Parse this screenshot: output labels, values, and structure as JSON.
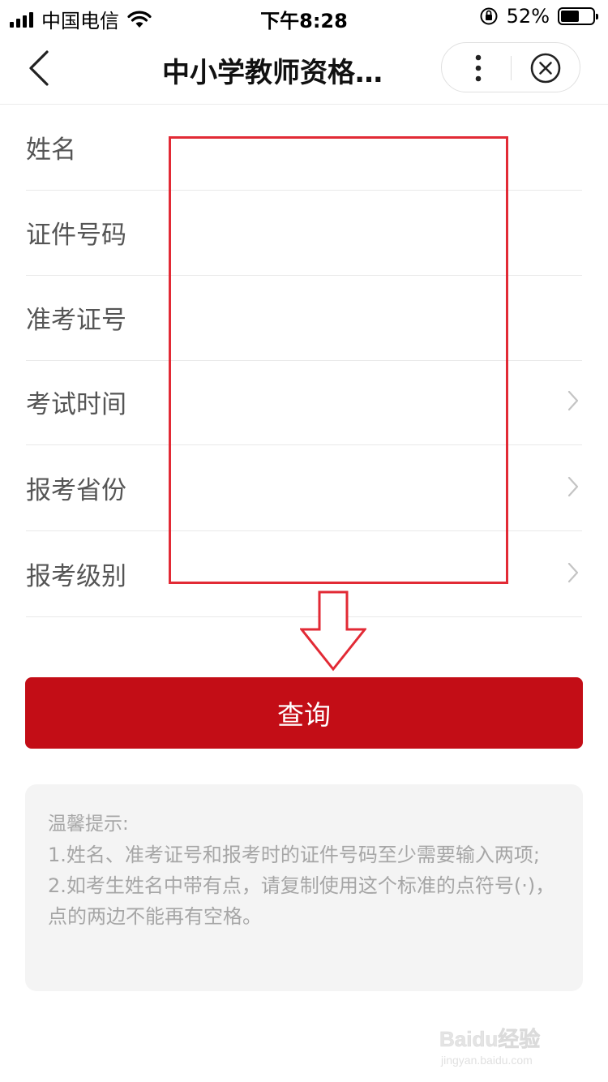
{
  "status_bar": {
    "carrier": "中国电信",
    "time": "下午8:28",
    "battery": "52%"
  },
  "nav": {
    "title": "中小学教师资格…"
  },
  "form": {
    "rows": [
      {
        "label": "姓名",
        "has_chevron": false
      },
      {
        "label": "证件号码",
        "has_chevron": false
      },
      {
        "label": "准考证号",
        "has_chevron": false
      },
      {
        "label": "考试时间",
        "has_chevron": true
      },
      {
        "label": "报考省份",
        "has_chevron": true
      },
      {
        "label": "报考级别",
        "has_chevron": true
      }
    ]
  },
  "query_button": {
    "label": "查询"
  },
  "tips": {
    "title": "温馨提示:",
    "line1": "1.姓名、准考证号和报考时的证件号码至少需要输入两项;",
    "line2": "2.如考生姓名中带有点，请复制使用这个标准的点符号(·)，点的两边不能再有空格。"
  },
  "watermark": {
    "brand": "Baidu经验",
    "url": "jingyan.baidu.com"
  },
  "colors": {
    "accent": "#c30d16",
    "annotation": "#e22a35",
    "tips_bg": "#f4f4f4",
    "tips_text": "#a6a6a6"
  },
  "icons": [
    "signal-icon",
    "wifi-icon",
    "rotation-lock-icon",
    "battery-icon",
    "back-arrow-icon",
    "more-dots-icon",
    "close-circle-icon",
    "chevron-right-icon",
    "down-arrow-annotation-icon"
  ]
}
